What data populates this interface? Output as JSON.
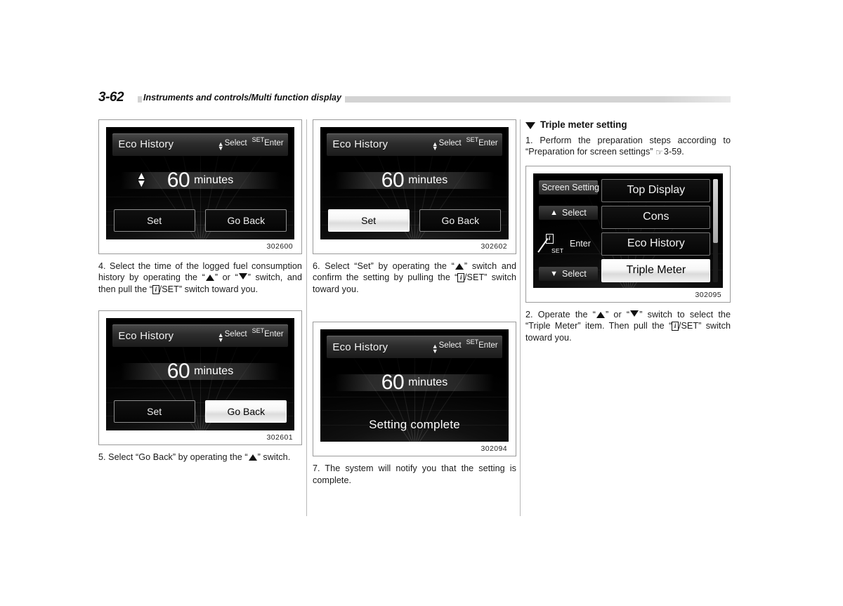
{
  "header": {
    "page_number": "3-62",
    "title": "Instruments and controls/Multi function display"
  },
  "screen_labels": {
    "eco_history": "Eco History",
    "select": "Select",
    "set_hint": "SET",
    "enter": "Enter",
    "value": "60",
    "unit": "minutes",
    "set_button": "Set",
    "go_back_button": "Go Back",
    "setting_complete": "Setting complete"
  },
  "figures": {
    "fig_302600": {
      "id": "302600",
      "selected": "none"
    },
    "fig_302601": {
      "id": "302601",
      "selected": "go_back"
    },
    "fig_302602": {
      "id": "302602",
      "selected": "set"
    },
    "fig_302094": {
      "id": "302094"
    },
    "fig_302095": {
      "id": "302095"
    }
  },
  "menu_screen": {
    "title_chip": "Screen Setting",
    "select_up": "Select",
    "select_down": "Select",
    "enter": "Enter",
    "set_mark": "SET",
    "items": [
      {
        "label": "Top Display",
        "selected": false
      },
      {
        "label": "Cons",
        "selected": false
      },
      {
        "label": "Eco History",
        "selected": false
      },
      {
        "label": "Triple Meter",
        "selected": true
      }
    ]
  },
  "column_1": {
    "step_4_part1": "4. Select the time of the logged fuel consumption history by operating the “",
    "step_4_part2": "” or “",
    "step_4_part3": "” switch, and then pull the “",
    "step_4_part4": "/SET” switch toward you.",
    "step_5_part1": "5. Select “Go Back” by operating the “",
    "step_5_part2": "” switch."
  },
  "column_2": {
    "step_6_part1": "6. Select “Set” by operating the “",
    "step_6_part2": "” switch and confirm the setting by pulling the “",
    "step_6_part3": "/SET” switch toward you.",
    "step_7": "7. The system will notify you that the setting is complete."
  },
  "column_3": {
    "section_heading": "Triple meter setting",
    "step_1_part1": "1. Perform the preparation steps according to “Preparation for screen settings” ",
    "step_1_ref": "3-59.",
    "step_2_part1": "2. Operate the “",
    "step_2_part2": "” or “",
    "step_2_part3": "” switch to select the “Triple Meter” item. Then pull the “",
    "step_2_part4": "/SET” switch toward you."
  },
  "icons": {
    "info_box": "i",
    "up_triangle": "▲",
    "down_triangle": "▼",
    "pointing_hand": "☞"
  },
  "colors": {
    "rule": "#d3d3d3",
    "figure_border": "#9a9a9a",
    "divider": "#b9b9b9",
    "screen_bg": "#000000",
    "selected_bg": "#ffffff",
    "text": "#1a1a1a"
  }
}
